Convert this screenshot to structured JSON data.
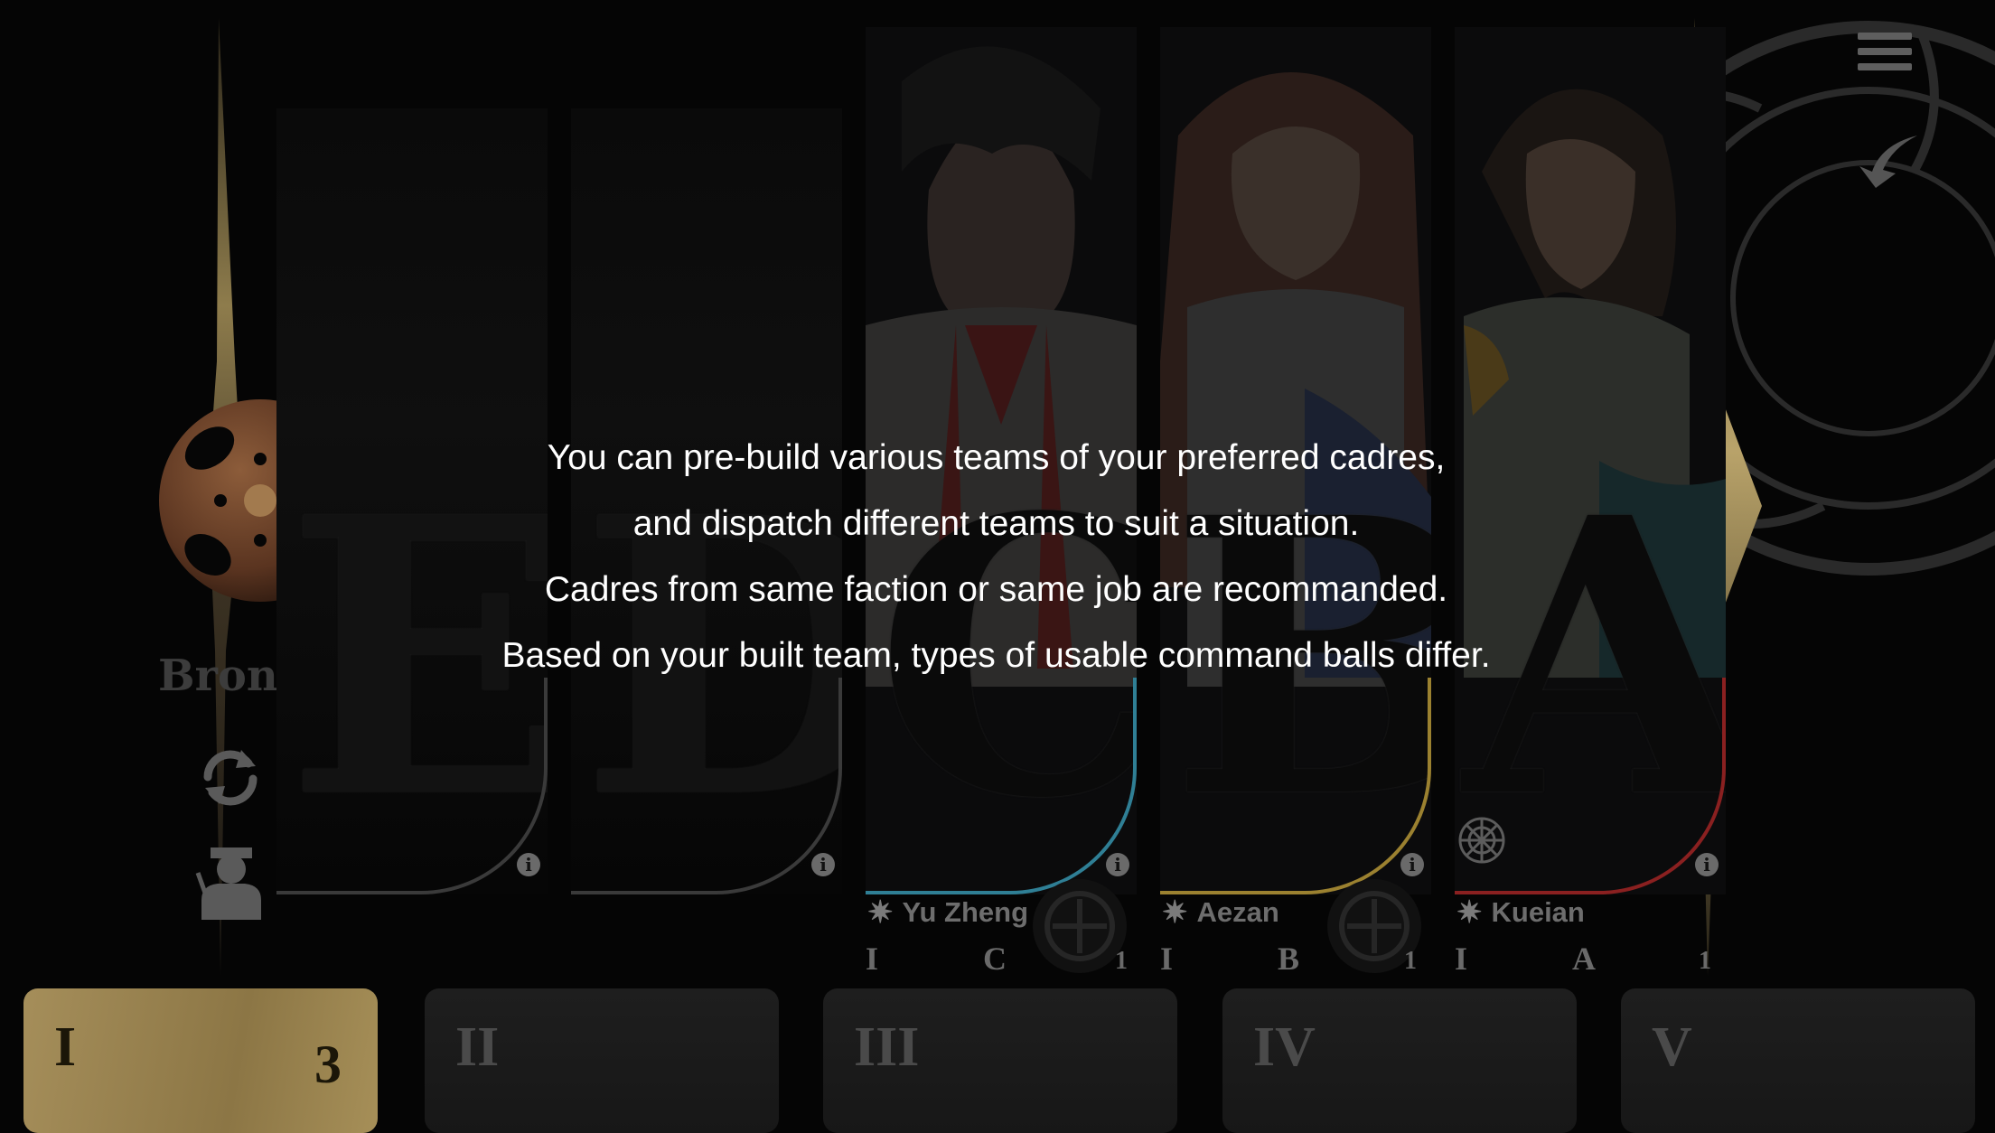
{
  "rank_label": "Bronze I",
  "tutorial_lines": [
    "You can pre-build various teams of your preferred cadres,",
    "and dispatch different teams to suit a situation.",
    "Cadres from same faction or same job are recommanded.",
    "Based on your built team, types of usable command balls differ."
  ],
  "slots": [
    {
      "letter": "E",
      "info": "i"
    },
    {
      "letter": "D",
      "info": "i"
    },
    {
      "letter": "C",
      "info": "i"
    },
    {
      "letter": "B",
      "info": "i"
    },
    {
      "letter": "A",
      "info": "i"
    }
  ],
  "characters": [
    {
      "name": "Yu Zheng",
      "tier": "I",
      "grade": "C",
      "level": "1"
    },
    {
      "name": "Aezan",
      "tier": "I",
      "grade": "B",
      "level": "1"
    },
    {
      "name": "Kueian",
      "tier": "I",
      "grade": "A",
      "level": "1"
    }
  ],
  "team_tabs": [
    {
      "label": "I",
      "count": "3",
      "active": true
    },
    {
      "label": "II",
      "active": false
    },
    {
      "label": "III",
      "active": false
    },
    {
      "label": "IV",
      "active": false
    },
    {
      "label": "V",
      "active": false
    }
  ],
  "icons": {
    "menu": "hamburger-menu-icon",
    "back": "back-arrow-icon",
    "swap": "swap-arrows-icon",
    "manager": "manager-avatar-icon",
    "faction": "sun-star-icon"
  },
  "colors": {
    "active_tab": "#a58e5a",
    "inactive_tab": "#1e1e1e",
    "slot_c_accent": "#2f7f95",
    "slot_b_accent": "#9b8130",
    "slot_a_accent": "#8a2020",
    "needle_gold": "#b9a36a"
  }
}
